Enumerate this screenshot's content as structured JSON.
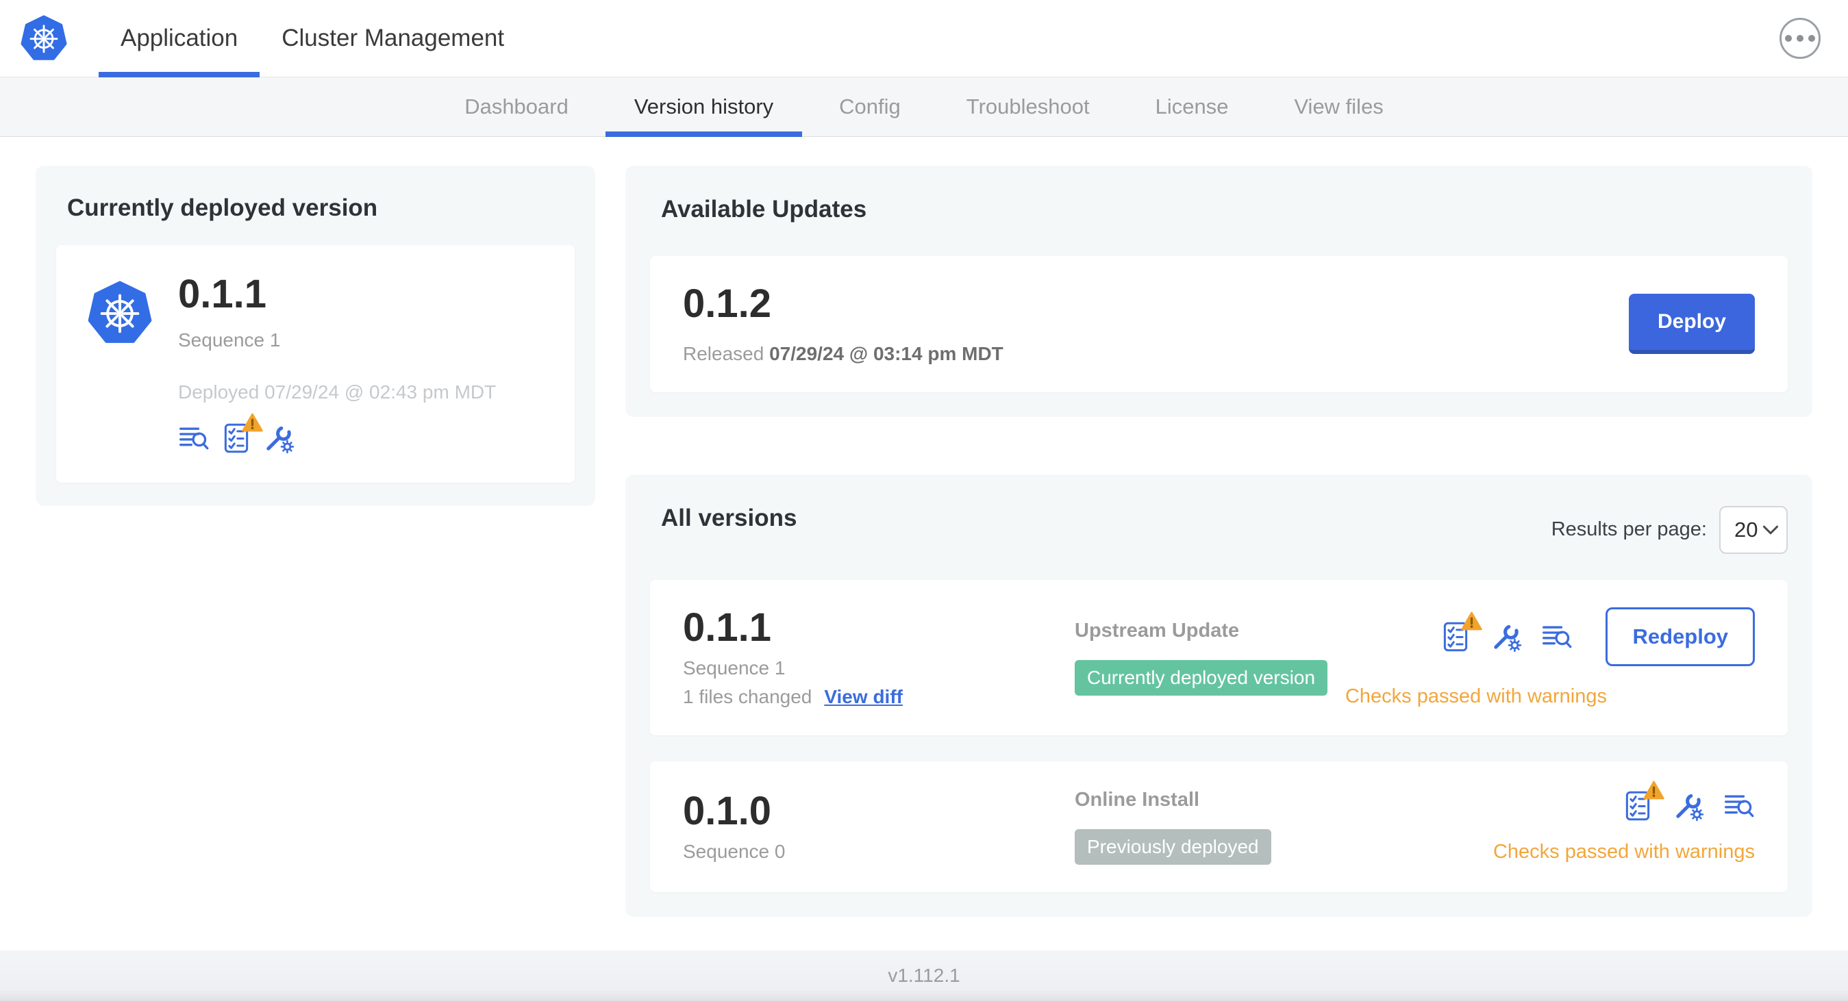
{
  "header": {
    "tabs": [
      {
        "label": "Application",
        "active": true
      },
      {
        "label": "Cluster Management",
        "active": false
      }
    ],
    "more_menu_icon": "ellipsis-icon"
  },
  "subnav": {
    "items": [
      {
        "label": "Dashboard",
        "active": false
      },
      {
        "label": "Version history",
        "active": true
      },
      {
        "label": "Config",
        "active": false
      },
      {
        "label": "Troubleshoot",
        "active": false
      },
      {
        "label": "License",
        "active": false
      },
      {
        "label": "View files",
        "active": false
      }
    ]
  },
  "current_version_card": {
    "title": "Currently deployed version",
    "app_icon": "kubernetes-logo-icon",
    "version": "0.1.1",
    "sequence": "Sequence 1",
    "deployed": "Deployed 07/29/24 @ 02:43 pm MDT",
    "icons": [
      "view-logs-icon",
      "preflight-checks-warning-icon",
      "config-icon"
    ]
  },
  "available_updates": {
    "title": "Available Updates",
    "version": "0.1.2",
    "released_label": "Released",
    "released_date": "07/29/24 @ 03:14 pm MDT",
    "deploy_button": "Deploy"
  },
  "all_versions": {
    "title": "All versions",
    "results_per_page_label": "Results per page:",
    "results_per_page_value": "20",
    "rows": [
      {
        "version": "0.1.1",
        "sequence": "Sequence 1",
        "files_changed": "1 files changed",
        "view_diff": "View diff",
        "source": "Upstream Update",
        "badge": "Currently deployed version",
        "badge_color": "#65c4a0",
        "icons": [
          "preflight-checks-warning-icon",
          "config-icon",
          "view-logs-icon"
        ],
        "action_button": "Redeploy",
        "status": "Checks passed with warnings"
      },
      {
        "version": "0.1.0",
        "sequence": "Sequence 0",
        "source": "Online Install",
        "badge": "Previously deployed",
        "badge_color": "#b4bebc",
        "icons": [
          "preflight-checks-warning-icon",
          "config-icon",
          "view-logs-icon"
        ],
        "status": "Checks passed with warnings"
      }
    ]
  },
  "footer": {
    "version": "v1.112.1"
  },
  "colors": {
    "accent_blue": "#3b6cde",
    "logo_blue": "#326de6",
    "badge_green": "#65c4a0",
    "badge_gray": "#b4bebc",
    "warning_amber": "#f2a63b",
    "card_background": "#f5f8f9"
  }
}
